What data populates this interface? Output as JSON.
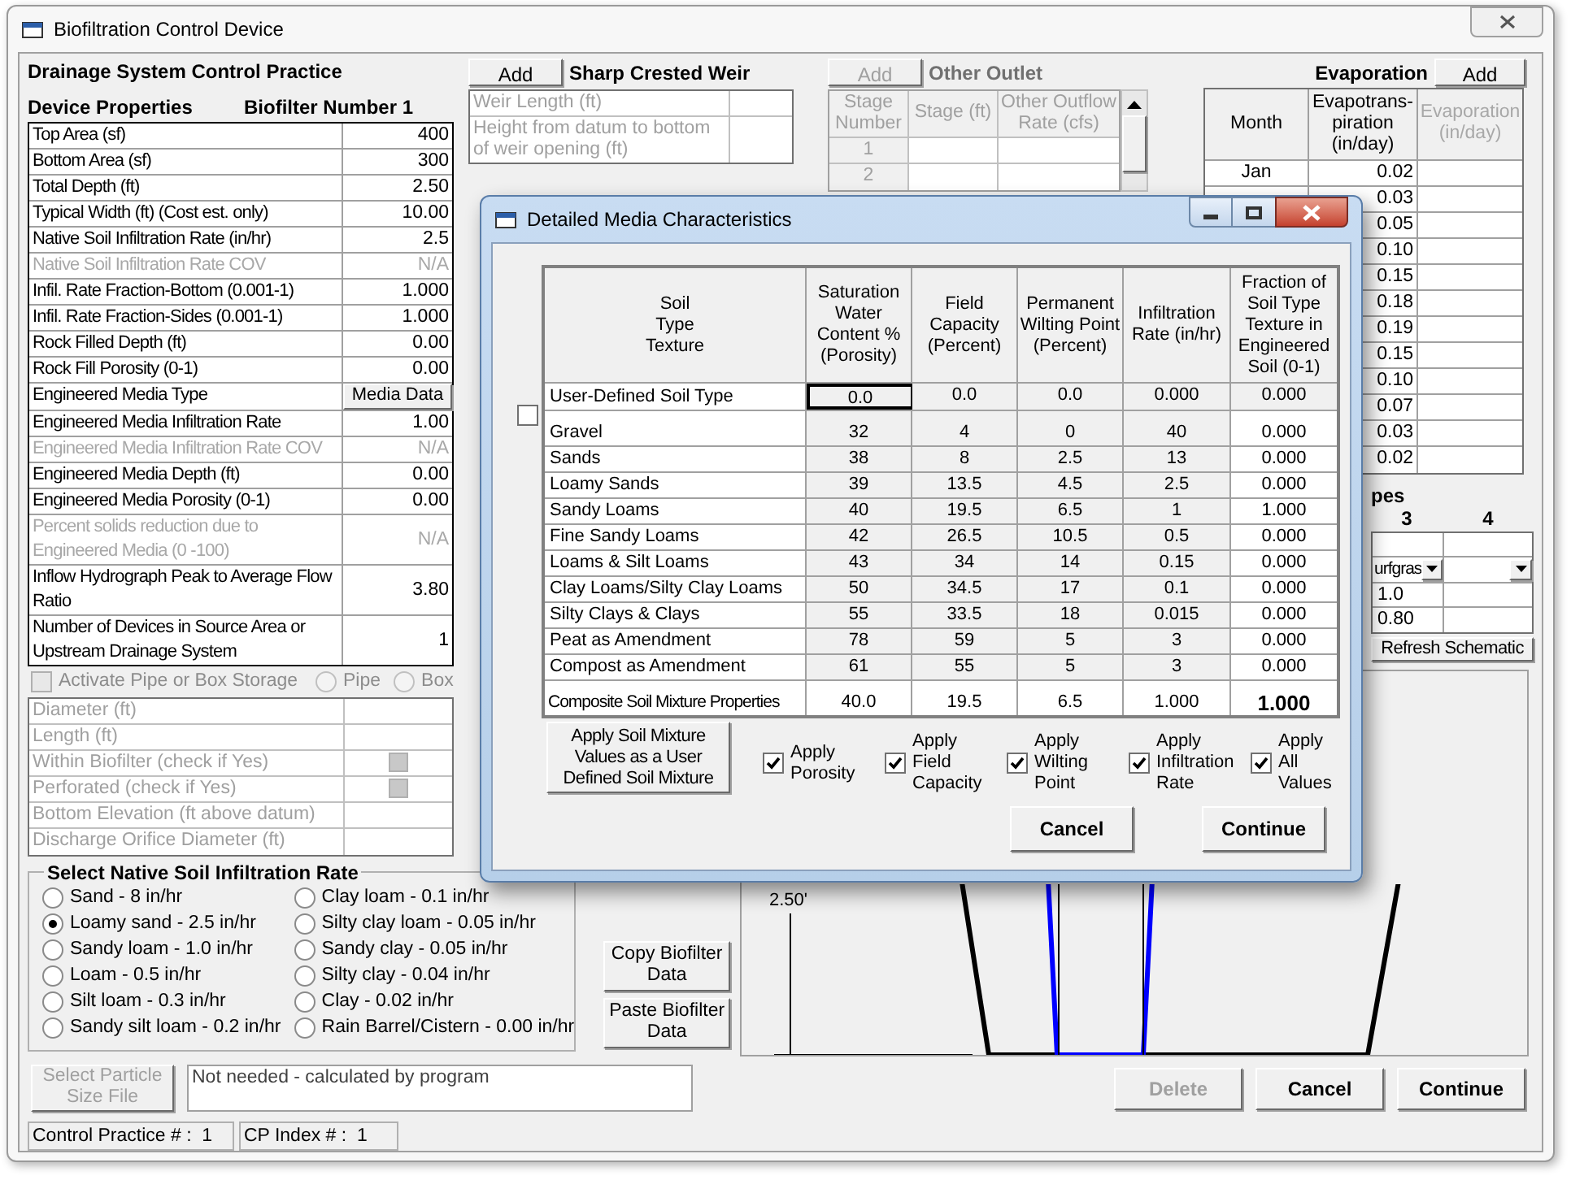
{
  "window": {
    "title": "Biofiltration Control Device"
  },
  "practice_title": "Drainage System Control Practice",
  "device_properties": {
    "heading": "Device Properties",
    "number": "Biofilter Number 1",
    "rows": [
      {
        "label": "Top Area (sf)",
        "value": "400",
        "kind": "text",
        "disabled": false
      },
      {
        "label": "Bottom Area (sf)",
        "value": "300",
        "kind": "text",
        "disabled": false
      },
      {
        "label": "Total Depth (ft)",
        "value": "2.50",
        "kind": "text",
        "disabled": false
      },
      {
        "label": "Typical Width (ft) (Cost est. only)",
        "value": "10.00",
        "kind": "text",
        "disabled": false
      },
      {
        "label": "Native Soil Infiltration Rate (in/hr)",
        "value": "2.5",
        "kind": "text",
        "disabled": false
      },
      {
        "label": "Native Soil Infiltration Rate COV",
        "value": "N/A",
        "kind": "text",
        "disabled": true
      },
      {
        "label": "Infil. Rate Fraction-Bottom (0.001-1)",
        "value": "1.000",
        "kind": "text",
        "disabled": false
      },
      {
        "label": "Infil. Rate Fraction-Sides (0.001-1)",
        "value": "1.000",
        "kind": "text",
        "disabled": false
      },
      {
        "label": "Rock Filled Depth (ft)",
        "value": "0.00",
        "kind": "text",
        "disabled": false
      },
      {
        "label": "Rock Fill Porosity (0-1)",
        "value": "0.00",
        "kind": "text",
        "disabled": false
      },
      {
        "label": "Engineered Media Type",
        "value": "Media Data",
        "kind": "button",
        "disabled": false
      },
      {
        "label": "Engineered Media Infiltration Rate",
        "value": "1.00",
        "kind": "text",
        "disabled": false
      },
      {
        "label": "Engineered Media Infiltration Rate COV",
        "value": "N/A",
        "kind": "text",
        "disabled": true
      },
      {
        "label": "Engineered Media Depth (ft)",
        "value": "0.00",
        "kind": "text",
        "disabled": false
      },
      {
        "label": "Engineered Media Porosity (0-1)",
        "value": "0.00",
        "kind": "text",
        "disabled": false
      },
      {
        "label": "Percent solids reduction due to Engineered Media (0 -100)",
        "value": "N/A",
        "kind": "text",
        "disabled": true
      },
      {
        "label": "Inflow Hydrograph Peak to Average Flow Ratio",
        "value": "3.80",
        "kind": "text",
        "disabled": false
      },
      {
        "label": "Number of Devices in Source Area or Upstream Drainage System",
        "value": "1",
        "kind": "text",
        "disabled": false
      }
    ]
  },
  "pipe_storage": {
    "label": "Activate Pipe or Box Storage",
    "checked": false,
    "disabled": true,
    "options": [
      {
        "label": "Pipe",
        "selected": false
      },
      {
        "label": "Box",
        "selected": false
      }
    ],
    "rows": [
      {
        "label": "Diameter (ft)",
        "kind": "text"
      },
      {
        "label": "Length (ft)",
        "kind": "text"
      },
      {
        "label": "Within Biofilter (check if Yes)",
        "kind": "checkbox",
        "checked": false
      },
      {
        "label": "Perforated (check if Yes)",
        "kind": "checkbox",
        "checked": false
      },
      {
        "label": "Bottom Elevation (ft above datum)",
        "kind": "text"
      },
      {
        "label": "Discharge Orifice Diameter (ft)",
        "kind": "text"
      }
    ]
  },
  "sharp_weir": {
    "add_button": "Add",
    "title": "Sharp Crested Weir",
    "rows": [
      "Weir Length (ft)",
      "Height from datum to bottom of weir opening (ft)"
    ]
  },
  "other_outlet": {
    "add_button": "Add",
    "add_disabled": true,
    "title": "Other Outlet",
    "columns": [
      "Stage Number",
      "Stage (ft)",
      "Other Outflow Rate (cfs)"
    ],
    "rows": [
      "1",
      "2"
    ]
  },
  "evaporation": {
    "title": "Evaporation",
    "add_button": "Add",
    "columns": [
      {
        "label": "Month",
        "disabled": false
      },
      {
        "label": "Evapotrans-piration (in/day)",
        "disabled": false
      },
      {
        "label": "Evaporation (in/day)",
        "disabled": true
      }
    ],
    "rows": [
      {
        "month": "Jan",
        "value": "0.02"
      },
      {
        "value": "0.03"
      },
      {
        "value": "0.05"
      },
      {
        "value": "0.10"
      },
      {
        "value": "0.15"
      },
      {
        "value": "0.18"
      },
      {
        "value": "0.19"
      },
      {
        "value": "0.15"
      },
      {
        "value": "0.10"
      },
      {
        "value": "0.07"
      },
      {
        "value": "0.03"
      },
      {
        "value": "0.02"
      }
    ]
  },
  "types": {
    "heading": "pes",
    "columns": [
      "3",
      "4"
    ],
    "dropdown_values": [
      "urfgras"
    ],
    "rows": [
      [
        "1.0"
      ],
      [
        "0.80"
      ]
    ],
    "refresh_button": "Refresh Schematic"
  },
  "infiltration_group": {
    "title": "Select Native Soil Infiltration Rate",
    "options": [
      {
        "label": "Sand - 8 in/hr",
        "selected": false
      },
      {
        "label": "Loamy sand - 2.5 in/hr",
        "selected": true
      },
      {
        "label": "Sandy loam - 1.0 in/hr",
        "selected": false
      },
      {
        "label": "Loam - 0.5 in/hr",
        "selected": false
      },
      {
        "label": "Silt loam - 0.3 in/hr",
        "selected": false
      },
      {
        "label": "Sandy silt loam - 0.2 in/hr",
        "selected": false
      },
      {
        "label": "Clay loam - 0.1 in/hr",
        "selected": false
      },
      {
        "label": "Silty clay loam - 0.05 in/hr",
        "selected": false
      },
      {
        "label": "Sandy clay - 0.05 in/hr",
        "selected": false
      },
      {
        "label": "Silty clay - 0.04 in/hr",
        "selected": false
      },
      {
        "label": "Clay - 0.02 in/hr",
        "selected": false
      },
      {
        "label": "Rain Barrel/Cistern - 0.00 in/hr",
        "selected": false
      }
    ]
  },
  "copy_button": "Copy Biofilter Data",
  "paste_button": "Paste Biofilter Data",
  "particle_button": {
    "label": "Select Particle Size File",
    "disabled": true
  },
  "particle_note": "Not needed - calculated by program",
  "status_bar": [
    "Control Practice # :  1",
    "CP Index # :  1"
  ],
  "schematic": {
    "depth_label": "2.50'"
  },
  "buttons": [
    {
      "label": "Delete",
      "disabled": true
    },
    {
      "label": "Cancel",
      "disabled": false
    },
    {
      "label": "Continue",
      "disabled": false
    }
  ],
  "dialog": {
    "title": "Detailed Media Characteristics",
    "columns": [
      "Soil\nType\nTexture",
      "Saturation Water Content % (Porosity)",
      "Field Capacity (Percent)",
      "Permanent Wilting Point (Percent)",
      "Infiltration Rate (in/hr)",
      "Fraction of Soil Type Texture in Engineered Soil (0-1)"
    ],
    "user_defined": {
      "checked": false,
      "label": "User-Defined Soil Type",
      "values": [
        "0.0",
        "0.0",
        "0.0",
        "0.000",
        "0.000"
      ]
    },
    "rows": [
      {
        "name": "Gravel",
        "values": [
          "32",
          "4",
          "0",
          "40",
          "0.000"
        ]
      },
      {
        "name": "Sands",
        "values": [
          "38",
          "8",
          "2.5",
          "13",
          "0.000"
        ]
      },
      {
        "name": "Loamy Sands",
        "values": [
          "39",
          "13.5",
          "4.5",
          "2.5",
          "0.000"
        ]
      },
      {
        "name": "Sandy Loams",
        "values": [
          "40",
          "19.5",
          "6.5",
          "1",
          "1.000"
        ]
      },
      {
        "name": "Fine Sandy Loams",
        "values": [
          "42",
          "26.5",
          "10.5",
          "0.5",
          "0.000"
        ]
      },
      {
        "name": "Loams & Silt Loams",
        "values": [
          "43",
          "34",
          "14",
          "0.15",
          "0.000"
        ]
      },
      {
        "name": "Clay Loams/Silty Clay Loams",
        "values": [
          "50",
          "34.5",
          "17",
          "0.1",
          "0.000"
        ]
      },
      {
        "name": "Silty Clays & Clays",
        "values": [
          "55",
          "33.5",
          "18",
          "0.015",
          "0.000"
        ]
      },
      {
        "name": "Peat as Amendment",
        "values": [
          "78",
          "59",
          "5",
          "3",
          "0.000"
        ]
      },
      {
        "name": "Compost as Amendment",
        "values": [
          "61",
          "55",
          "5",
          "3",
          "0.000"
        ]
      }
    ],
    "composite": {
      "label": "Composite Soil Mixture Properties",
      "values": [
        "40.0",
        "19.5",
        "6.5",
        "1.000",
        "1.000"
      ]
    },
    "apply_button": "Apply Soil Mixture Values as a User Defined Soil Mixture",
    "apply_options": [
      {
        "label": "Apply Porosity",
        "checked": true
      },
      {
        "label": "Apply Field Capacity",
        "checked": true
      },
      {
        "label": "Apply Wilting Point",
        "checked": true
      },
      {
        "label": "Apply Infiltration Rate",
        "checked": true
      },
      {
        "label": "Apply All Values",
        "checked": true
      }
    ],
    "buttons": [
      "Cancel",
      "Continue"
    ]
  }
}
